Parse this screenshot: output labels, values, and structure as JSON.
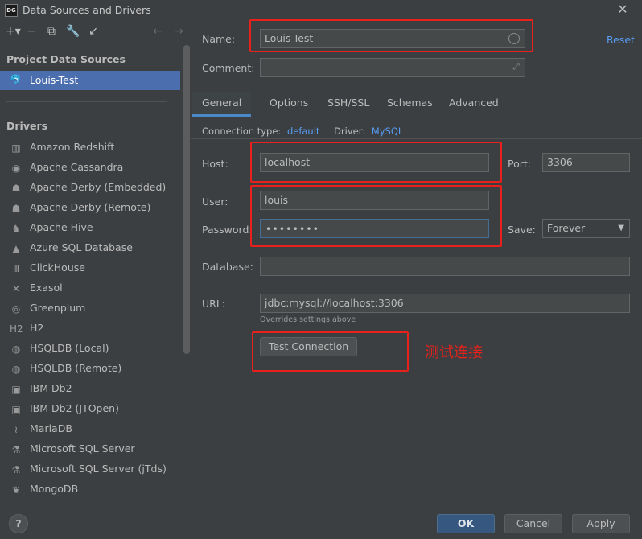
{
  "window": {
    "title": "Data Sources and Drivers",
    "app_badge": "DG"
  },
  "left": {
    "toolbar": [
      {
        "name": "add-icon",
        "glyph": "+▾"
      },
      {
        "name": "remove-icon",
        "glyph": "−"
      },
      {
        "name": "duplicate-icon",
        "glyph": "⧉"
      },
      {
        "name": "wrench-icon",
        "glyph": "🔧"
      },
      {
        "name": "go-to-icon",
        "glyph": "↙"
      },
      {
        "name": "back-icon",
        "glyph": "←"
      },
      {
        "name": "forward-icon",
        "glyph": "→"
      }
    ],
    "project_title": "Project Data Sources",
    "selected_source": "Louis-Test",
    "drivers_title": "Drivers",
    "drivers": [
      {
        "label": "Amazon Redshift",
        "icon": "▥"
      },
      {
        "label": "Apache Cassandra",
        "icon": "◉"
      },
      {
        "label": "Apache Derby (Embedded)",
        "icon": "☗"
      },
      {
        "label": "Apache Derby (Remote)",
        "icon": "☗"
      },
      {
        "label": "Apache Hive",
        "icon": "♞"
      },
      {
        "label": "Azure SQL Database",
        "icon": "▲"
      },
      {
        "label": "ClickHouse",
        "icon": "Ⅲ"
      },
      {
        "label": "Exasol",
        "icon": "✕"
      },
      {
        "label": "Greenplum",
        "icon": "◎"
      },
      {
        "label": "H2",
        "icon": "H2"
      },
      {
        "label": "HSQLDB (Local)",
        "icon": "◍"
      },
      {
        "label": "HSQLDB (Remote)",
        "icon": "◍"
      },
      {
        "label": "IBM Db2",
        "icon": "▣"
      },
      {
        "label": "IBM Db2 (JTOpen)",
        "icon": "▣"
      },
      {
        "label": "MariaDB",
        "icon": "≀"
      },
      {
        "label": "Microsoft SQL Server",
        "icon": "⚗"
      },
      {
        "label": "Microsoft SQL Server (jTds)",
        "icon": "⚗"
      },
      {
        "label": "MongoDB",
        "icon": "❦"
      }
    ]
  },
  "form": {
    "name_label": "Name:",
    "name_value": "Louis-Test",
    "reset": "Reset",
    "comment_label": "Comment:",
    "comment_value": "",
    "tabs": [
      "General",
      "Options",
      "SSH/SSL",
      "Schemas",
      "Advanced"
    ],
    "conn_type_label": "Connection type:",
    "conn_type_value": "default",
    "driver_label": "Driver:",
    "driver_value": "MySQL",
    "host_label": "Host:",
    "host_value": "localhost",
    "port_label": "Port:",
    "port_value": "3306",
    "user_label": "User:",
    "user_value": "louis",
    "password_label": "Password:",
    "password_value": "••••••••",
    "save_label": "Save:",
    "save_value": "Forever",
    "database_label": "Database:",
    "database_value": "",
    "url_label": "URL:",
    "url_value": "jdbc:mysql://localhost:3306",
    "url_hint": "Overrides settings above",
    "test_connection": "Test Connection",
    "annotation": "测试连接"
  },
  "footer": {
    "help": "?",
    "ok": "OK",
    "cancel": "Cancel",
    "apply": "Apply"
  },
  "colors": {
    "accent": "#4b6eaf",
    "link": "#589df6",
    "annotation_red": "#e8211c"
  }
}
